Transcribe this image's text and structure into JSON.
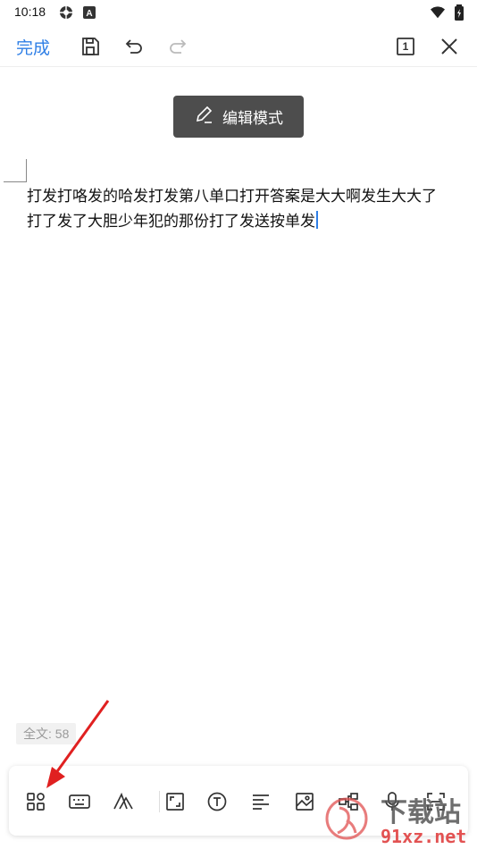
{
  "status_bar": {
    "time": "10:18",
    "left_icons": [
      "gear-notification-icon",
      "a-notification-icon"
    ],
    "right_icons": [
      "wifi-icon",
      "battery-icon"
    ]
  },
  "toolbar": {
    "done_label": "完成",
    "page_count": "1",
    "icons": [
      "save-icon",
      "undo-icon",
      "redo-icon",
      "page-count-icon",
      "close-icon"
    ]
  },
  "mode_chip": {
    "label": "编辑模式",
    "icon": "pencil-icon"
  },
  "document": {
    "line1": "打发打咯发的哈发打发第八单口打开答案是大大啊发生大大了",
    "line2": "打了发了大胆少年犯的那份打了发送按单发"
  },
  "word_count": "全文: 58",
  "bottom_toolbar": {
    "icons": [
      "apps-grid-icon",
      "keyboard-icon",
      "font-style-icon",
      "expand-icon",
      "text-box-icon",
      "align-left-icon",
      "image-icon",
      "mindmap-icon",
      "microphone-icon",
      "scan-icon"
    ]
  },
  "watermark": {
    "brand": "下载站",
    "domain": "91xz.net"
  },
  "colors": {
    "accent": "#2f7fe6",
    "annotation_arrow": "#e02020",
    "chip_bg": "#4d4d4d"
  }
}
